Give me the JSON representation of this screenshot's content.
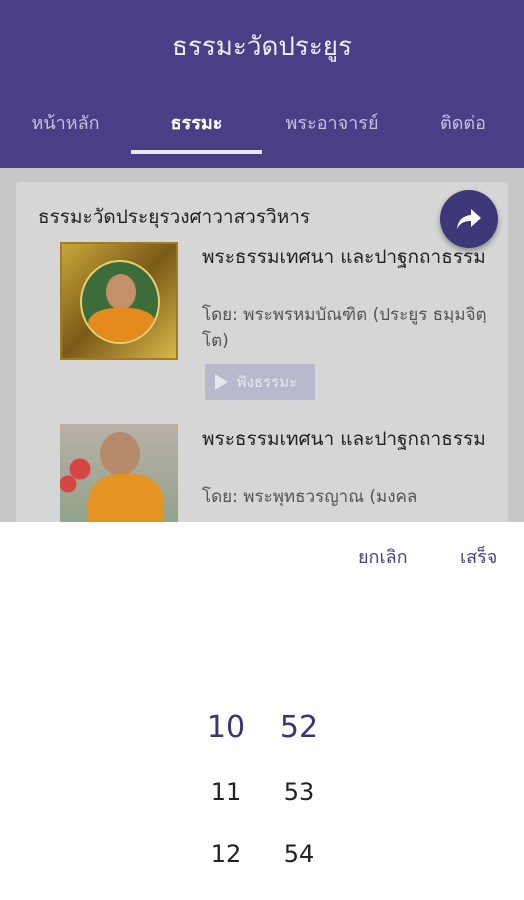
{
  "header": {
    "title": "ธรรมะวัดประยูร",
    "tabs": [
      {
        "label": "หน้าหลัก",
        "active": false
      },
      {
        "label": "ธรรมะ",
        "active": true
      },
      {
        "label": "พระอาจารย์",
        "active": false
      },
      {
        "label": "ติดต่อ",
        "active": false
      }
    ]
  },
  "content": {
    "section_title": "ธรรมะวัดประยุรวงศาวาสวรวิหาร",
    "items": [
      {
        "title": "พระธรรมเทศนา และปาฐกถาธรรม",
        "by": "โดย: พระพรหมบัณฑิต (ประยูร ธมฺมจิตฺโต)",
        "button_label": "ฟังธรรมะ"
      },
      {
        "title": "พระธรรมเทศนา และปาฐกถาธรรม",
        "by": "โดย: พระพุทธวรญาณ (มงคล ",
        "button_label": ""
      }
    ],
    "share_icon": "share-icon"
  },
  "picker": {
    "cancel_label": "ยกเลิก",
    "done_label": "เสร็จ",
    "hours": [
      "10",
      "11",
      "12"
    ],
    "minutes": [
      "52",
      "53",
      "54"
    ],
    "selected_hour": "10",
    "selected_minute": "52"
  },
  "colors": {
    "primary": "#4a3f86",
    "fab": "#3e3778",
    "overlay": "#c7c7c7"
  }
}
